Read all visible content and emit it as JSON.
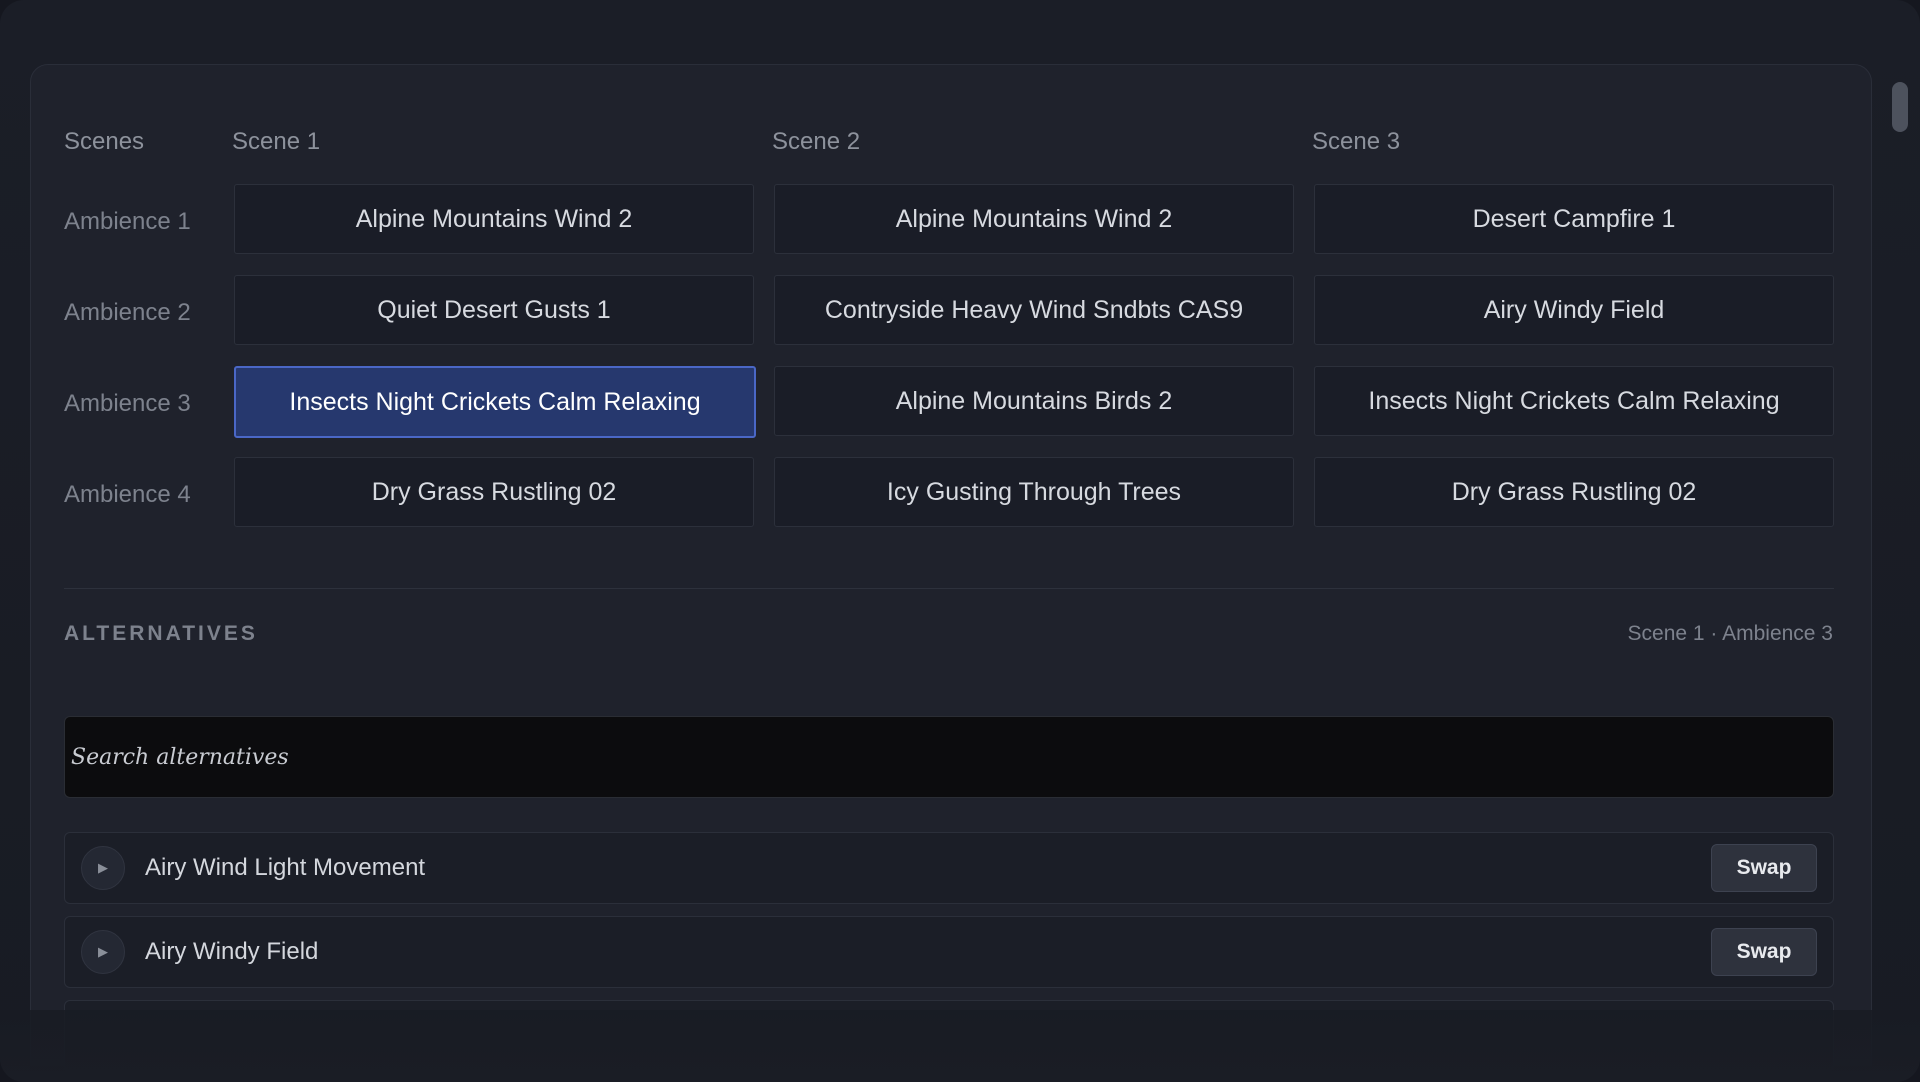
{
  "grid": {
    "corner_label": "Scenes",
    "scenes": [
      "Scene 1",
      "Scene 2",
      "Scene 3"
    ],
    "rows": [
      {
        "label": "Ambience 1",
        "cells": [
          "Alpine Mountains Wind 2",
          "Alpine Mountains Wind 2",
          "Desert Campfire 1"
        ]
      },
      {
        "label": "Ambience 2",
        "cells": [
          "Quiet Desert Gusts 1",
          "Contryside Heavy Wind Sndbts CAS9",
          "Airy Windy Field"
        ]
      },
      {
        "label": "Ambience 3",
        "cells": [
          "Insects Night Crickets Calm Relaxing",
          "Alpine Mountains Birds 2",
          "Insects Night Crickets Calm Relaxing"
        ]
      },
      {
        "label": "Ambience 4",
        "cells": [
          "Dry Grass Rustling 02",
          "Icy Gusting Through Trees",
          "Dry Grass Rustling 02"
        ]
      }
    ],
    "selected": {
      "scene": "Scene 1",
      "ambience": "Ambience 3"
    }
  },
  "alternatives": {
    "title": "ALTERNATIVES",
    "context": "Scene 1 · Ambience 3",
    "search_placeholder": "Search alternatives",
    "items": [
      {
        "name": "Airy Wind Light Movement",
        "action": "Swap"
      },
      {
        "name": "Airy Windy Field",
        "action": "Swap"
      }
    ]
  },
  "icons": {
    "play": "play-icon"
  },
  "colors": {
    "selected_bg": "#26386e",
    "selected_border": "#4a67c6",
    "panel_bg": "#1f222c"
  }
}
